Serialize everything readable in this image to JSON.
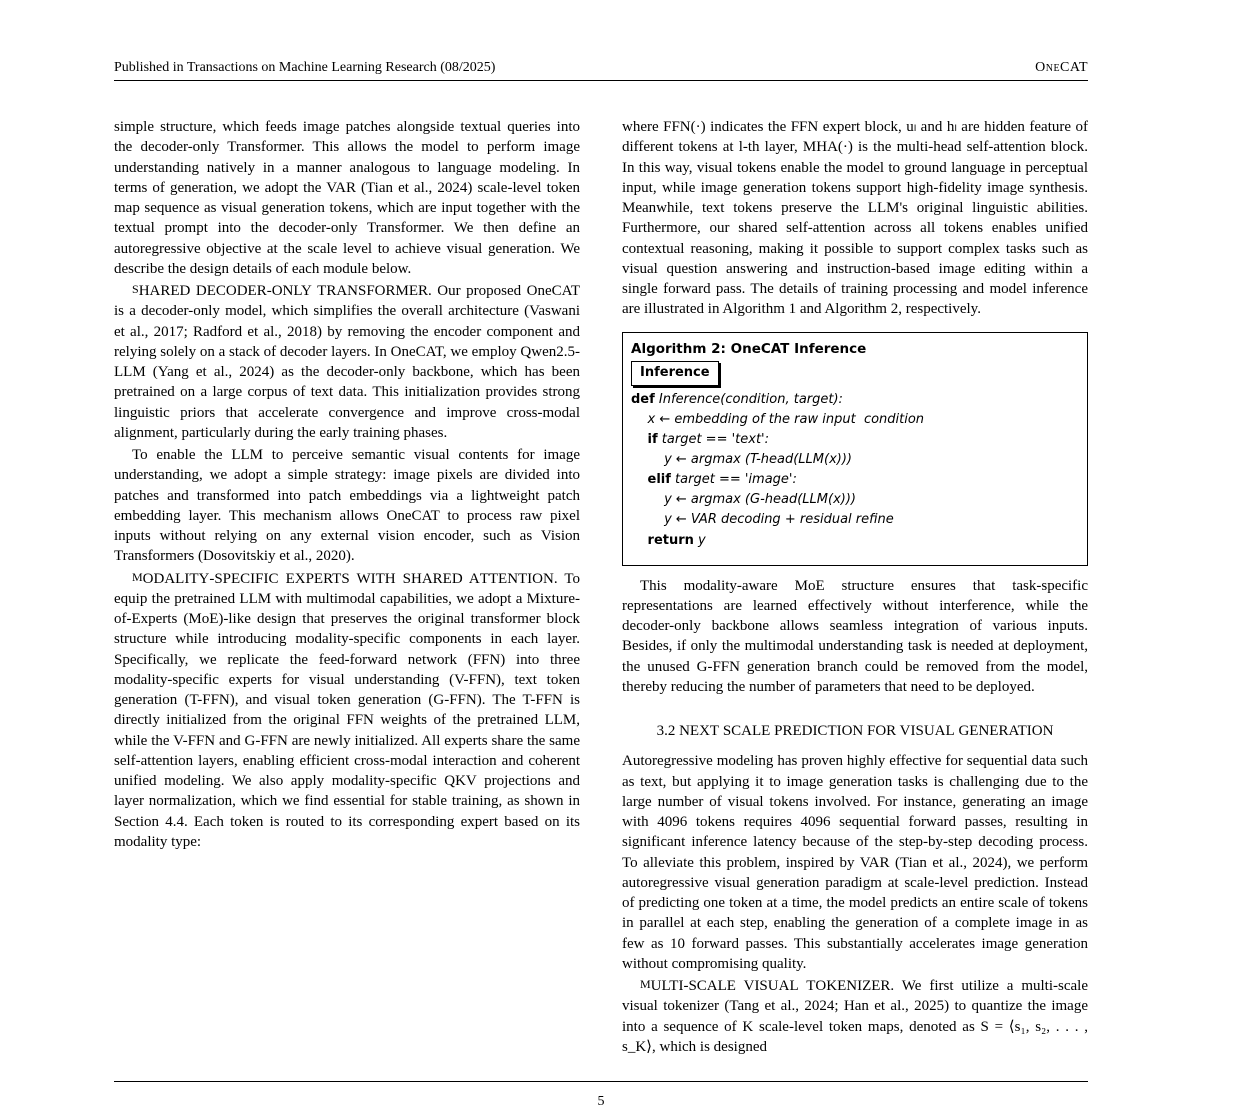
{
  "header": {
    "left": "Published in Transactions on Machine Learning Research (08/2025)",
    "right": "OneCAT"
  },
  "left_col": {
    "p1": "simple structure, which feeds image patches alongside textual queries into the decoder-only Transformer. This allows the model to perform image understanding natively in a manner analogous to language modeling. In terms of generation, we adopt the VAR (Tian et al., 2024) scale-level token map sequence as visual generation tokens, which are input together with the textual prompt into the decoder-only Transformer. We then define an autoregressive objective at the scale level to achieve visual generation. We describe the design details of each module below.",
    "p2_parts": [
      "S",
      "HARED",
      " D",
      "ECODER",
      "-",
      "ONLY",
      " T",
      "RANSFORMER",
      ". Our proposed OneCAT is a decoder-only model, which simplifies the overall architecture (Vaswani et al., 2017; Radford et al., 2018) by removing the encoder component and relying solely on a stack of decoder layers. In OneCAT, we employ Qwen2.5-LLM (Yang et al., 2024) as the decoder-only backbone, which has been pretrained on a large corpus of text data. This initialization provides strong linguistic priors that accelerate convergence and improve cross-modal alignment, particularly during the early training phases."
    ],
    "p3": "To enable the LLM to perceive semantic visual contents for image understanding, we adopt a simple strategy: image pixels are divided into patches and transformed into patch embeddings via a lightweight patch embedding layer. This mechanism allows OneCAT to process raw pixel inputs without relying on any external vision encoder, such as Vision Transformers (Dosovitskiy et al., 2020).",
    "p4_parts": [
      "M",
      "ODALITY",
      "-S",
      "PECIFIC",
      " E",
      "XPERTS WITH",
      " S",
      "HARED",
      " A",
      "TTENTION",
      ". To equip the pretrained LLM with multimodal capabilities, we adopt a Mixture-of-Experts (MoE)-like design that preserves the original transformer block structure while introducing modality-specific components in each layer. Specifically, we replicate the feed-forward network (FFN) into three modality-specific experts for visual understanding (V-FFN), text token generation (T-FFN), and visual token generation (G-FFN). The T-FFN is directly initialized from the original FFN weights of the pretrained LLM, while the V-FFN and G-FFN are newly initialized. All experts share the same self-attention layers, enabling efficient cross-modal interaction and coherent unified modeling. We also apply modality-specific QKV projections and layer normalization, which we find essential for stable training, as shown in Section 4.4. Each token is routed to its corresponding expert based on its modality type:"
    ]
  },
  "right_col": {
    "above_box": "where FFN(·) indicates the FFN expert block, uₗ and hₗ are hidden feature of different tokens at l-th layer, MHA(·) is the multi-head self-attention block. In this way, visual tokens enable the model to ground language in perceptual input, while image generation tokens support high-fidelity image synthesis. Meanwhile, text tokens preserve the LLM's original linguistic abilities. Furthermore, our shared self-attention across all tokens enables unified contextual reasoning, making it possible to support complex tasks such as visual question answering and instruction-based image editing within a single forward pass. The details of training processing and model inference are illustrated in Algorithm 1 and Algorithm 2, respectively.",
    "algo": {
      "title": "Algorithm 2: OneCAT Inference",
      "func_label": "Inference",
      "lines": [
        {
          "ind": 0,
          "kw": "def",
          "rest": " Inference(condition, target):"
        },
        {
          "ind": 1,
          "text": "x ← embedding of the raw input  condition"
        },
        {
          "ind": 1,
          "kw": "if",
          "rest": " target == 'text':"
        },
        {
          "ind": 2,
          "text": "y ← argmax (T-head(LLM(x)))"
        },
        {
          "ind": 1,
          "kw": "elif",
          "rest": " target == 'image':"
        },
        {
          "ind": 2,
          "text": "y ← argmax (G-head(LLM(x)))"
        },
        {
          "ind": 2,
          "text": "y ← VAR decoding + residual refine"
        },
        {
          "ind": 1,
          "kw": "return",
          "rest": " y"
        }
      ]
    },
    "below_box": "This modality-aware MoE structure ensures that task-specific representations are learned effectively without interference, while the decoder-only backbone allows seamless integration of various inputs. Besides, if only the multimodal understanding task is needed at deployment, the unused G-FFN generation branch could be removed from the model, thereby reducing the number of parameters that need to be deployed.",
    "subhead_parts": [
      "3.2 ",
      "N",
      "EXT",
      " S",
      "CALE",
      " P",
      "REDICTION FOR",
      " V",
      "ISUAL",
      " G",
      "ENERATION"
    ],
    "sp1": "Autoregressive modeling has proven highly effective for sequential data such as text, but applying it to image generation tasks is challenging due to the large number of visual tokens involved. For instance, generating an image with 4096 tokens requires 4096 sequential forward passes, resulting in significant inference latency because of the step-by-step decoding process. To alleviate this problem, inspired by VAR (Tian et al., 2024), we perform autoregressive visual generation paradigm at scale-level prediction. Instead of predicting one token at a time, the model predicts an entire scale of tokens in parallel at each step, enabling the generation of a complete image in as few as 10 forward passes. This substantially accelerates image generation without compromising quality.",
    "sp2_parts": [
      "M",
      "ULTI",
      "-S",
      "CALE",
      " V",
      "ISUAL",
      " T",
      "OKENIZER",
      ". We first utilize a multi-scale visual tokenizer (Tang et al., 2024; Han et al., 2025) to quantize the image into a sequence of K scale-level token maps, denoted as S = ⟨s₁, s₂, . . . , s_K⟩, which is designed"
    ]
  },
  "footer_page": "5"
}
